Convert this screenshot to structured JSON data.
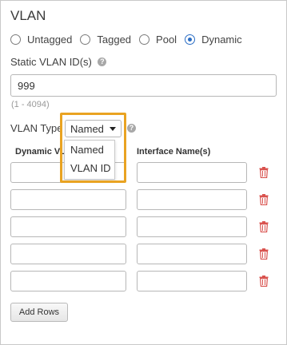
{
  "section": {
    "title": "VLAN"
  },
  "mode": {
    "options": [
      {
        "label": "Untagged",
        "checked": false
      },
      {
        "label": "Tagged",
        "checked": false
      },
      {
        "label": "Pool",
        "checked": false
      },
      {
        "label": "Dynamic",
        "checked": true
      }
    ]
  },
  "static_vlan": {
    "label": "Static VLAN ID(s)",
    "value": "999",
    "range_hint": "(1 - 4094)"
  },
  "vlan_type": {
    "label": "VLAN Type",
    "selected": "Named",
    "options": [
      "Named",
      "VLAN ID"
    ]
  },
  "table": {
    "col_dynamic": "Dynamic VLA",
    "col_interface": "Interface Name(s)",
    "row_count": 5
  },
  "add_rows_label": "Add Rows",
  "colors": {
    "accent": "#2a6dc4",
    "highlight": "#e9a322",
    "delete": "#d9534f"
  }
}
